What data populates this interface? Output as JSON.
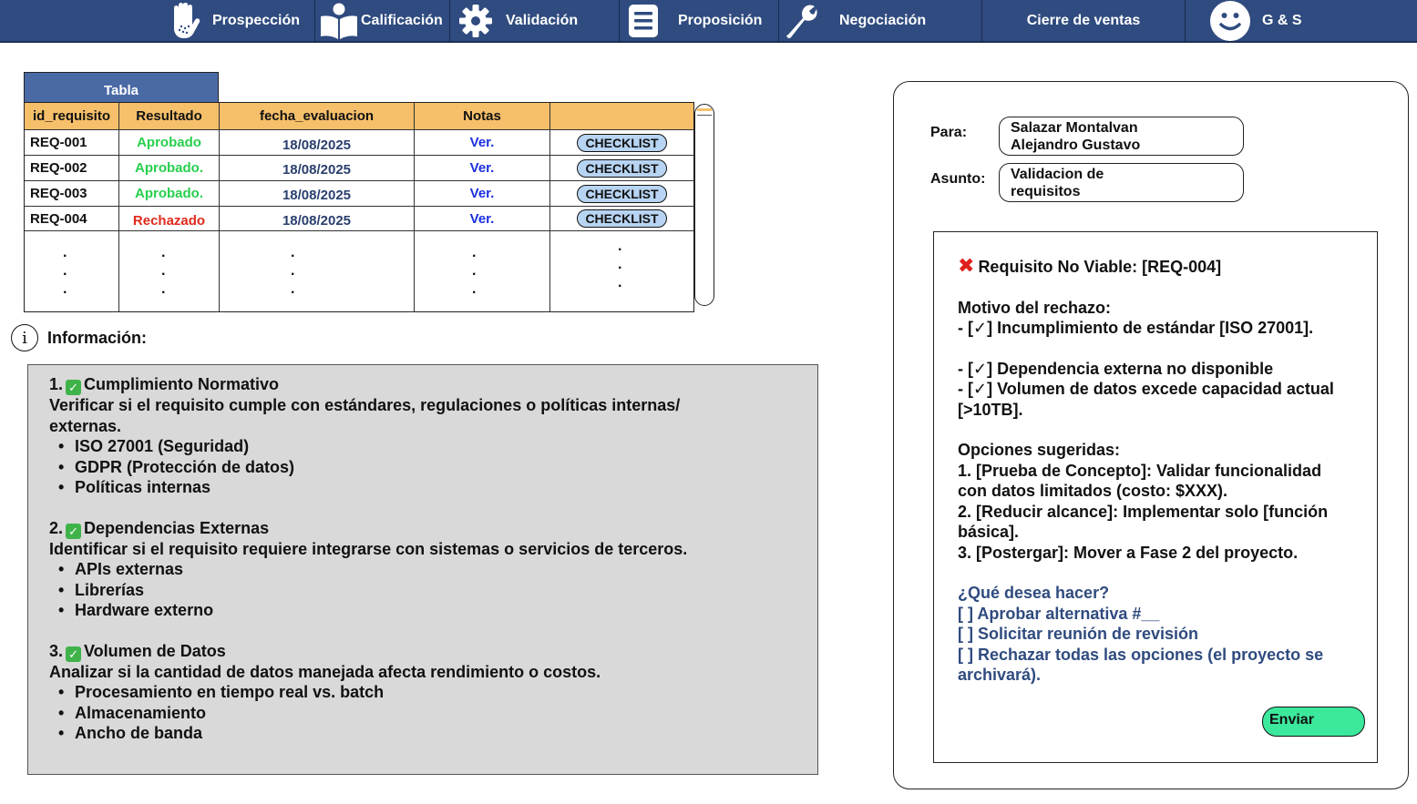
{
  "nav": {
    "items": [
      {
        "label": "Prospección",
        "icon": "hand-icon"
      },
      {
        "label": "Calificación",
        "icon": "book-icon"
      },
      {
        "label": "Validación",
        "icon": "gear-icon"
      },
      {
        "label": "Proposición",
        "icon": "document-icon"
      },
      {
        "label": "Negociación",
        "icon": "wrench-icon"
      },
      {
        "label": "Cierre de ventas",
        "icon": ""
      },
      {
        "label": "G & S",
        "icon": "smiley-icon"
      }
    ]
  },
  "table": {
    "tab_label": "Tabla",
    "headers": [
      "id_requisito",
      "Resultado",
      "fecha_evaluacion",
      "Notas",
      ""
    ],
    "rows": [
      {
        "id": "REQ-001",
        "result": "Aprobado",
        "status": "ok",
        "date": "18/08/2025",
        "notes": "Ver.",
        "action": "CHECKLIST"
      },
      {
        "id": "REQ-002",
        "result": "Aprobado.",
        "status": "ok",
        "date": "18/08/2025",
        "notes": "Ver.",
        "action": "CHECKLIST"
      },
      {
        "id": "REQ-003",
        "result": "Aprobado.",
        "status": "ok",
        "date": "18/08/2025",
        "notes": "Ver.",
        "action": "CHECKLIST"
      },
      {
        "id": "REQ-004",
        "result": "Rechazado",
        "status": "bad",
        "date": "18/08/2025",
        "notes": "Ver.",
        "action": "CHECKLIST"
      }
    ]
  },
  "info": {
    "title": "Información:",
    "sections": [
      {
        "number": "1.",
        "heading": "Cumplimiento Normativo",
        "description": "Verificar si el requisito cumple con estándares, regulaciones o políticas internas/ externas.",
        "bullets": [
          "ISO 27001 (Seguridad)",
          "GDPR (Protección de datos)",
          "Políticas internas"
        ]
      },
      {
        "number": "2.",
        "heading": "Dependencias Externas",
        "description": "Identificar si el requisito requiere integrarse con sistemas o servicios de terceros.",
        "bullets": [
          "APIs externas",
          "Librerías",
          "Hardware externo"
        ]
      },
      {
        "number": "3.",
        "heading": "Volumen de Datos",
        "description": "Analizar si la cantidad de datos manejada afecta rendimiento o costos.",
        "bullets": [
          "Procesamiento en tiempo real vs. batch",
          "Almacenamiento",
          "Ancho de banda"
        ]
      }
    ]
  },
  "mail": {
    "to_label": "Para:",
    "to_value_line1": "Salazar Montalvan",
    "to_value_line2": "Alejandro Gustavo",
    "subject_label": "Asunto:",
    "subject_line1": "Validacion de",
    "subject_line2": "requisitos",
    "message": {
      "title": "Requisito No Viable: [REQ-004]",
      "reason_heading": "Motivo del rechazo:",
      "reasons": [
        "- [✓] Incumplimiento de estándar [ISO 27001].",
        "- [✓] Dependencia externa no disponible",
        "- [✓] Volumen de datos excede capacidad actual [>10TB]."
      ],
      "options_heading": "Opciones sugeridas:",
      "options": [
        "1. [Prueba de Concepto]: Validar funcionalidad con datos limitados (costo: $XXX).",
        "2. [Reducir alcance]: Implementar solo [función básica].",
        "3. [Postergar]: Mover a Fase 2 del proyecto."
      ],
      "question": "¿Qué desea hacer?",
      "choices": [
        "[ ] Aprobar alternativa #__",
        "[ ] Solicitar reunión de revisión",
        "[ ] Rechazar todas las opciones (el proyecto se archivará)."
      ]
    },
    "send_label": "Enviar"
  },
  "colors": {
    "nav_bg": "#2f4b7f",
    "table_header": "#f6bf6a",
    "approved": "#27d04d",
    "rejected": "#e02a1c",
    "send_button": "#3be89c"
  }
}
